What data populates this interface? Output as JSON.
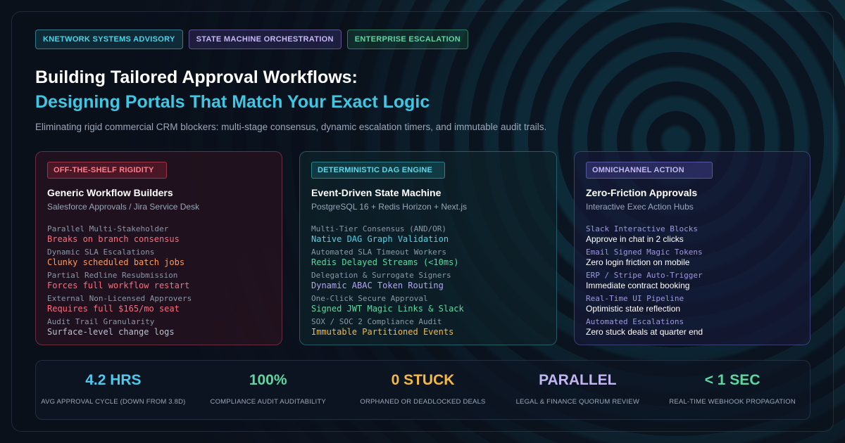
{
  "tags": [
    {
      "label": "KNETWORK SYSTEMS ADVISORY"
    },
    {
      "label": "STATE MACHINE ORCHESTRATION"
    },
    {
      "label": "ENTERPRISE ESCALATION"
    }
  ],
  "header": {
    "title_line1": "Building Tailored Approval Workflows:",
    "title_line2": "Designing Portals That Match Your Exact Logic",
    "subtitle": "Eliminating rigid commercial CRM blockers: multi-stage consensus, dynamic escalation timers, and immutable audit trails."
  },
  "cards": [
    {
      "badge": "OFF-THE-SHELF RIGIDITY",
      "title": "Generic Workflow Builders",
      "subtitle": "Salesforce Approvals / Jira Service Desk",
      "rows": [
        {
          "label": "Parallel Multi-Stakeholder",
          "value": "Breaks on branch consensus",
          "color": "#ff6b7d"
        },
        {
          "label": "Dynamic SLA Escalations",
          "value": "Clunky scheduled batch jobs",
          "color": "#ff9a5c"
        },
        {
          "label": "Partial Redline Resubmission",
          "value": "Forces full workflow restart",
          "color": "#ff6b7d"
        },
        {
          "label": "External Non-Licensed Approvers",
          "value": "Requires full $165/mo seat",
          "color": "#ff6b7d"
        },
        {
          "label": "Audit Trail Granularity",
          "value": "Surface-level change logs",
          "color": "#b8c2cf"
        }
      ]
    },
    {
      "badge": "DETERMINISTIC DAG ENGINE",
      "title": "Event-Driven State Machine",
      "subtitle": "PostgreSQL 16 + Redis Horizon + Next.js",
      "rows": [
        {
          "label": "Multi-Tier Consensus (AND/OR)",
          "value": "Native DAG Graph Validation",
          "color": "#4fd2e6"
        },
        {
          "label": "Automated SLA Timeout Workers",
          "value": "Redis Delayed Streams (<10ms)",
          "color": "#5fd6a0"
        },
        {
          "label": "Delegation & Surrogate Signers",
          "value": "Dynamic ABAC Token Routing",
          "color": "#b3a6f2"
        },
        {
          "label": "One-Click Secure Approval",
          "value": "Signed JWT Magic Links & Slack",
          "color": "#5fd6a0"
        },
        {
          "label": "SOX / SOC 2 Compliance Audit",
          "value": "Immutable Partitioned Events",
          "color": "#f5b942"
        }
      ]
    },
    {
      "badge": "OMNICHANNEL ACTION",
      "title": "Zero-Friction Approvals",
      "subtitle": "Interactive Exec Action Hubs",
      "rows": [
        {
          "label": "Slack Interactive Blocks",
          "value": "Approve in chat in 2 clicks",
          "color": "#ffffff"
        },
        {
          "label": "Email Signed Magic Tokens",
          "value": "Zero login friction on mobile",
          "color": "#ffffff"
        },
        {
          "label": "ERP / Stripe Auto-Trigger",
          "value": "Immediate contract booking",
          "color": "#ffffff"
        },
        {
          "label": "Real-Time UI Pipeline",
          "value": "Optimistic state reflection",
          "color": "#ffffff"
        },
        {
          "label": "Automated Escalations",
          "value": "Zero stuck deals at quarter end",
          "color": "#ffffff"
        }
      ]
    }
  ],
  "stats": [
    {
      "value": "4.2 HRS",
      "label": "AVG APPROVAL CYCLE (DOWN FROM 3.8D)",
      "color": "#4fc8ea"
    },
    {
      "value": "100%",
      "label": "COMPLIANCE AUDIT AUDITABILITY",
      "color": "#5fd6a0"
    },
    {
      "value": "0 STUCK",
      "label": "ORPHANED OR DEADLOCKED DEALS",
      "color": "#f5b942"
    },
    {
      "value": "PARALLEL",
      "label": "LEGAL & FINANCE QUORUM REVIEW",
      "color": "#c1b6f2"
    },
    {
      "value": "< 1 SEC",
      "label": "REAL-TIME WEBHOOK PROPAGATION",
      "color": "#5fd6a0"
    }
  ]
}
